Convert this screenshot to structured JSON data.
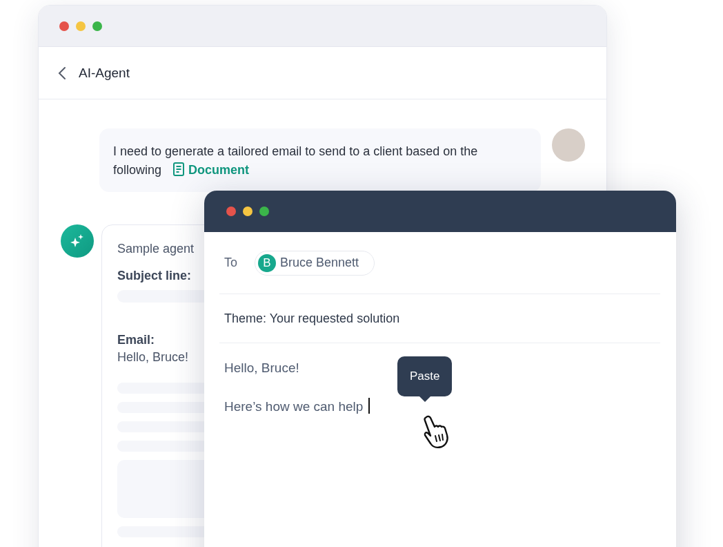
{
  "agent_window": {
    "title": "AI-Agent",
    "user_message": {
      "text": "I need to generate a tailored email to send to a client based on the following",
      "attachment": "Document"
    },
    "agent_card": {
      "title": "Sample agent",
      "subject_label": "Subject line:",
      "email_label": "Email:",
      "email_greeting": "Hello, Bruce!"
    }
  },
  "email_window": {
    "to_label": "To",
    "recipient": {
      "initial": "B",
      "name": "Bruce Bennett"
    },
    "subject": "Theme: Your requested solution",
    "body": [
      "Hello, Bruce!",
      "Here’s how we can help"
    ],
    "tooltip": "Paste"
  }
}
